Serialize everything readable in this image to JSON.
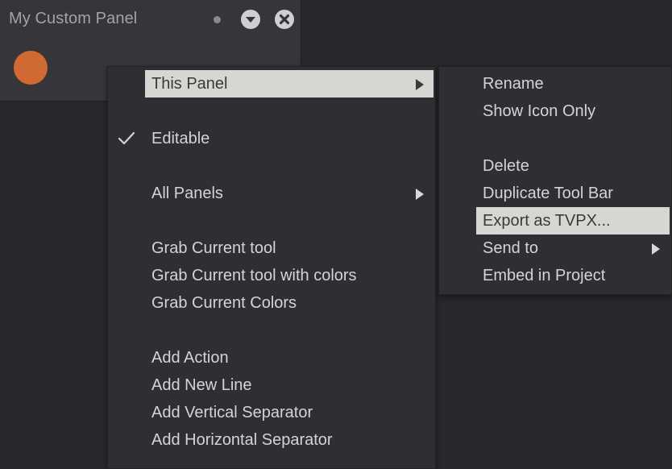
{
  "panel": {
    "title": "My Custom Panel",
    "swatch_color": "#d16a32"
  },
  "main_menu": {
    "this_panel": "This Panel",
    "editable": "Editable",
    "all_panels": "All Panels",
    "grab_tool": "Grab Current tool",
    "grab_tool_colors": "Grab Current tool with colors",
    "grab_colors": "Grab Current Colors",
    "add_action": "Add Action",
    "add_new_line": "Add New Line",
    "add_vertical_separator": "Add Vertical Separator",
    "add_horizontal_separator": "Add Horizontal Separator"
  },
  "sub_menu": {
    "rename": "Rename",
    "show_icon_only": "Show Icon Only",
    "delete": "Delete",
    "duplicate_tool_bar": "Duplicate Tool Bar",
    "export_tvpx": "Export as TVPX...",
    "send_to": "Send to",
    "embed_in_project": "Embed in Project"
  },
  "icons": {
    "panel_dot": "dot-icon",
    "collapse": "chevron-down-circle-icon",
    "close": "close-circle-icon",
    "check": "checkmark-icon",
    "submenu": "triangle-right-icon"
  },
  "colors": {
    "background": "#28282c",
    "panel": "#36363a",
    "menu": "#2f2f33",
    "highlight": "#d6d6d2",
    "text": "#d4d4d6"
  }
}
